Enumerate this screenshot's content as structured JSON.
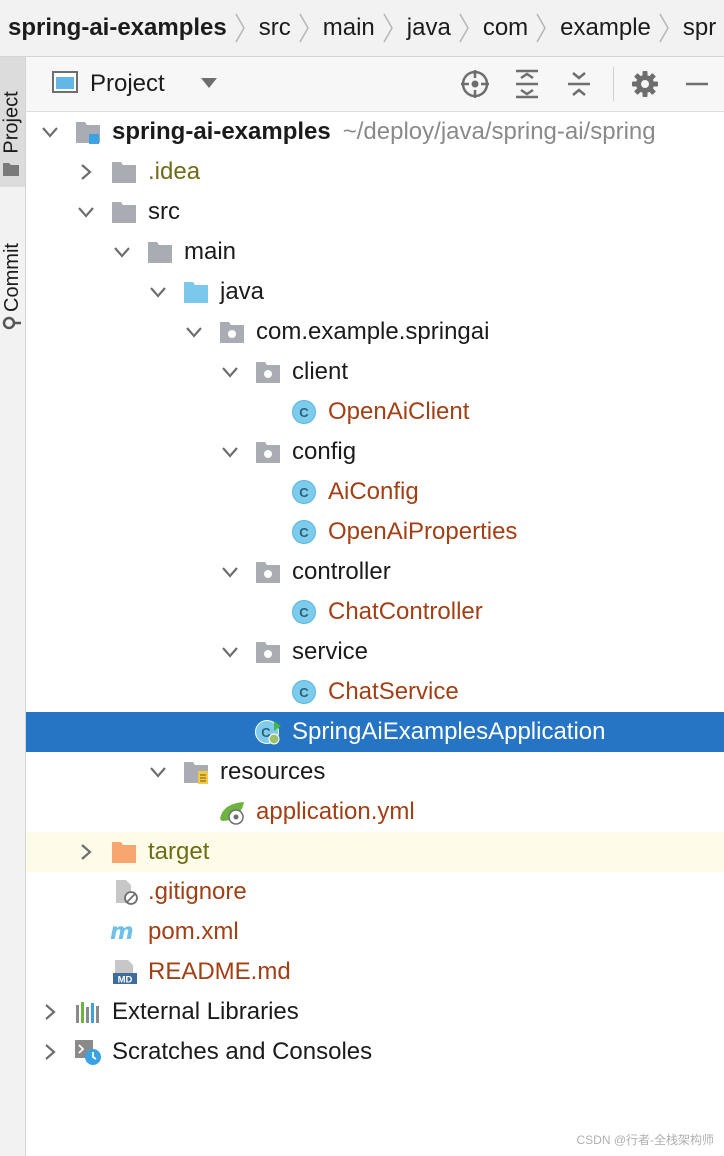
{
  "breadcrumb": [
    "spring-ai-examples",
    "src",
    "main",
    "java",
    "com",
    "example",
    "spr"
  ],
  "stripe": {
    "project_tab": "Project",
    "commit_tab": "Commit"
  },
  "toolbar": {
    "title": "Project",
    "dropdown_icon": "chevron-down-icon",
    "actions": [
      "locate-icon",
      "expand-all-icon",
      "collapse-all-icon",
      "gear-icon",
      "minimize-icon"
    ]
  },
  "tree": {
    "root": {
      "label": "spring-ai-examples",
      "path": "~/deploy/java/spring-ai/spring"
    },
    "idea": ".idea",
    "src": "src",
    "main": "main",
    "java": "java",
    "package": "com.example.springai",
    "client": "client",
    "openai_client": "OpenAiClient",
    "config": "config",
    "ai_config": "AiConfig",
    "openai_properties": "OpenAiProperties",
    "controller": "controller",
    "chat_controller": "ChatController",
    "service": "service",
    "chat_service": "ChatService",
    "application_class": "SpringAiExamplesApplication",
    "resources": "resources",
    "application_yml": "application.yml",
    "target": "target",
    "gitignore": ".gitignore",
    "pom": "pom.xml",
    "readme": "README.md",
    "external_libraries": "External Libraries",
    "scratches": "Scratches and Consoles"
  },
  "colors": {
    "selection": "#2675c4",
    "excluded_bg": "#fdfce9",
    "class_icon": "#57b6e0",
    "folder": "#a9adb3",
    "source_folder": "#7cc7ec",
    "target_folder": "#f7a670",
    "modified_text": "#a33f14",
    "ignored_text": "#6d6d16"
  },
  "watermark": "CSDN @行者-全栈架构师"
}
